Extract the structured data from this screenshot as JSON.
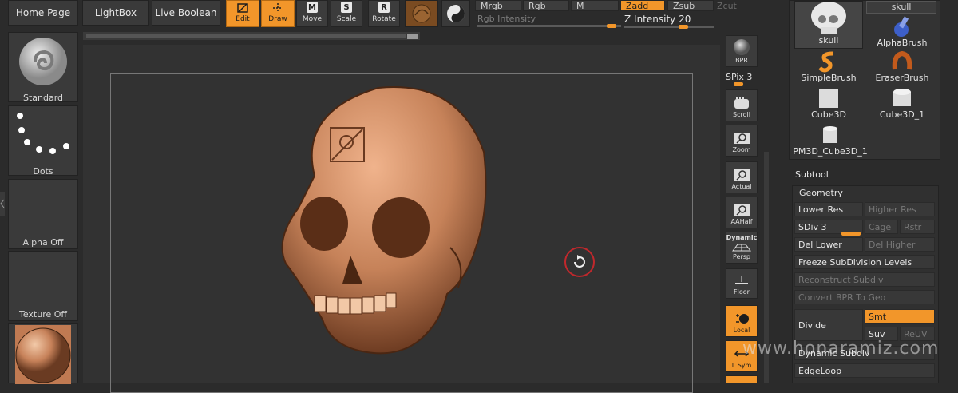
{
  "top": {
    "home_page": "Home Page",
    "lightbox": "LightBox",
    "live_boolean": "Live Boolean",
    "edit": "Edit",
    "draw": "Draw",
    "move": "Move",
    "scale": "Scale",
    "rotate": "Rotate",
    "mrgb": "Mrgb",
    "rgb": "Rgb",
    "m": "M",
    "zadd": "Zadd",
    "zsub": "Zsub",
    "zcut": "Zcut",
    "rgb_intensity": "Rgb Intensity",
    "z_intensity": "Z Intensity 20"
  },
  "left": {
    "standard": "Standard",
    "dots": "Dots",
    "alpha_off": "Alpha Off",
    "texture_off": "Texture Off"
  },
  "vstrip": {
    "bpr": "BPR",
    "spix": "SPix 3",
    "scroll": "Scroll",
    "zoom": "Zoom",
    "actual": "Actual",
    "aahalf": "AAHalf",
    "dynamic": "Dynamic",
    "persp": "Persp",
    "floor": "Floor",
    "local": "Local",
    "lsym": "L.Sym"
  },
  "tools": {
    "skull_tab": "skull",
    "skull": "skull",
    "alphabrush": "AlphaBrush",
    "simplebrush": "SimpleBrush",
    "eraserbrush": "EraserBrush",
    "cube3d": "Cube3D",
    "cube3d_1": "Cube3D_1",
    "pm3d_cube3d_1": "PM3D_Cube3D_1"
  },
  "panel": {
    "subtool": "Subtool",
    "geometry": "Geometry",
    "lower_res": "Lower Res",
    "higher_res": "Higher Res",
    "sdiv": "SDiv 3",
    "cage": "Cage",
    "rstr": "Rstr",
    "del_lower": "Del Lower",
    "del_higher": "Del Higher",
    "freeze": "Freeze SubDivision Levels",
    "reconstruct": "Reconstruct Subdiv",
    "convert_bpr": "Convert BPR To Geo",
    "divide": "Divide",
    "smt": "Smt",
    "suv": "Suv",
    "reuv": "ReUV",
    "dynamic_subdiv": "Dynamic Subdiv",
    "edgeloop": "EdgeLoop"
  },
  "watermark": "www.honaramiz.com",
  "colors": {
    "accent": "#f2962a",
    "bg": "#2b2b2b",
    "canvas": "#323232"
  }
}
